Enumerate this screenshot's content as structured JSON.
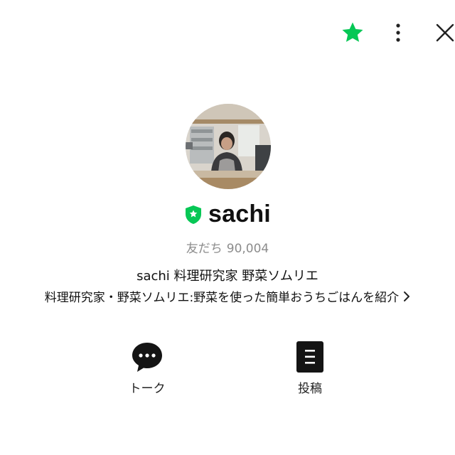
{
  "colors": {
    "accent": "#06c755",
    "text": "#111111",
    "muted": "#8c8c8c"
  },
  "topbar": {
    "favorite_icon": "star-icon",
    "more_icon": "more-vertical-icon",
    "close_icon": "close-icon"
  },
  "profile": {
    "name": "sachi",
    "badge_icon": "official-shield-icon",
    "friends_label": "友だち",
    "friends_count": "90,004",
    "title": "sachi 料理研究家 野菜ソムリエ",
    "description": "料理研究家・野菜ソムリエ:野菜を使った簡単おうちごはんを紹介"
  },
  "actions": [
    {
      "label": "トーク",
      "icon": "chat-bubble-icon"
    },
    {
      "label": "投稿",
      "icon": "post-list-icon"
    }
  ]
}
